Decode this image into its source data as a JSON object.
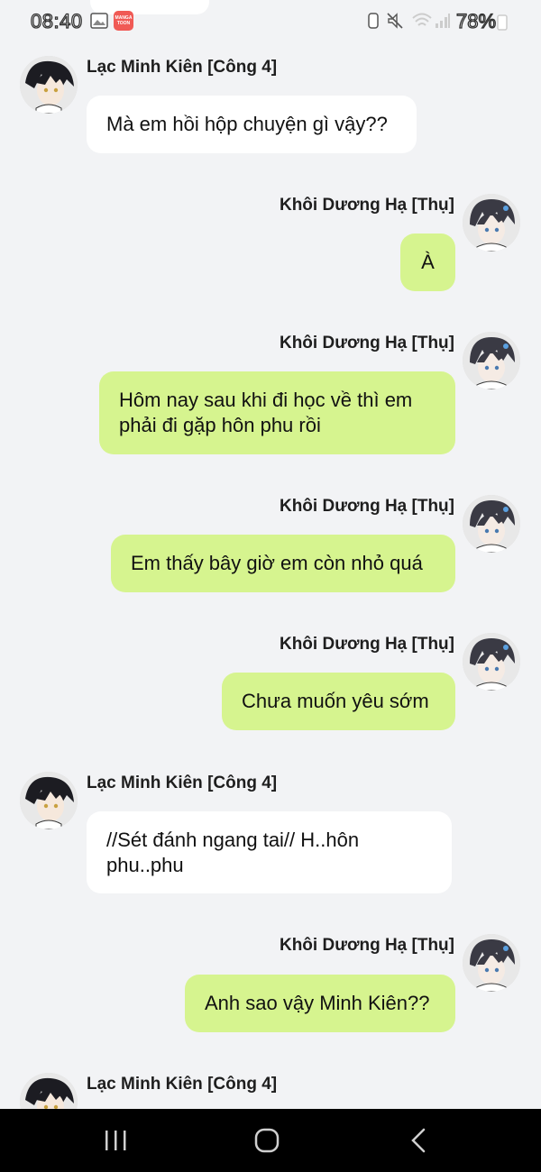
{
  "status_bar": {
    "time": "08:40",
    "app_badge_text": "MANGA TOON",
    "battery": "78%"
  },
  "messages": [
    {
      "side": "left",
      "sender": "Lạc Minh Kiên [Công 4]",
      "text": "Mà em hồi hộp chuyện gì vậy??"
    },
    {
      "side": "right",
      "sender": "Khôi Dương Hạ [Thụ]",
      "text": "À"
    },
    {
      "side": "right",
      "sender": "Khôi Dương Hạ [Thụ]",
      "text": "Hôm nay sau khi đi học về thì em phải đi gặp hôn phu rồi"
    },
    {
      "side": "right",
      "sender": "Khôi Dương Hạ [Thụ]",
      "text": "Em thấy bây giờ em còn nhỏ quá"
    },
    {
      "side": "right",
      "sender": "Khôi Dương Hạ [Thụ]",
      "text": "Chưa muốn yêu sớm"
    },
    {
      "side": "left",
      "sender": "Lạc Minh Kiên [Công 4]",
      "text": "//Sét đánh ngang tai// H..hôn phu..phu"
    },
    {
      "side": "right",
      "sender": "Khôi Dương Hạ [Thụ]",
      "text": "Anh sao vậy Minh Kiên??"
    },
    {
      "side": "left",
      "sender": "Lạc Minh Kiên [Công 4]",
      "text": ""
    }
  ],
  "colors": {
    "background": "#f2f3f5",
    "left_bubble": "#ffffff",
    "right_bubble": "#d6f48f",
    "nav_bar": "#000000"
  },
  "nav_bar": {
    "recents_icon": "recents-icon",
    "home_icon": "home-icon",
    "back_icon": "back-icon"
  }
}
